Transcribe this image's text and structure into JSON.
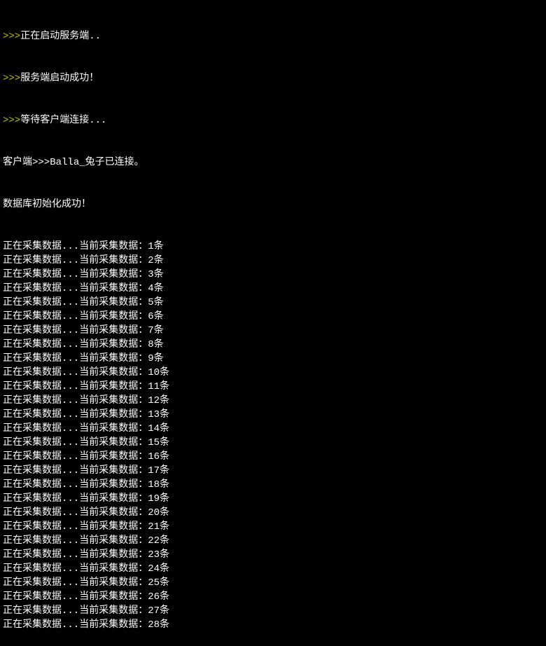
{
  "header": {
    "line1_prefix": ">>>",
    "line1_text": "正在启动服务端..",
    "line2_prefix": ">>>",
    "line2_text": "服务端启动成功！",
    "line3_prefix": ">>>",
    "line3_text": "等待客户端连接...",
    "line4_prefix": "客户端>>>",
    "line4_text": "Balla_兔子已连接。",
    "line5_text": "数据库初始化成功！"
  },
  "data_prefix": "正在采集数据...当前采集数据：",
  "data_suffix": "条",
  "data_lines": [
    "1",
    "2",
    "3",
    "4",
    "5",
    "6",
    "7",
    "8",
    "9",
    "10",
    "11",
    "12",
    "13",
    "14",
    "15",
    "16",
    "17",
    "18",
    "19",
    "20",
    "21",
    "22",
    "23",
    "24",
    "25",
    "26",
    "27",
    "28"
  ]
}
